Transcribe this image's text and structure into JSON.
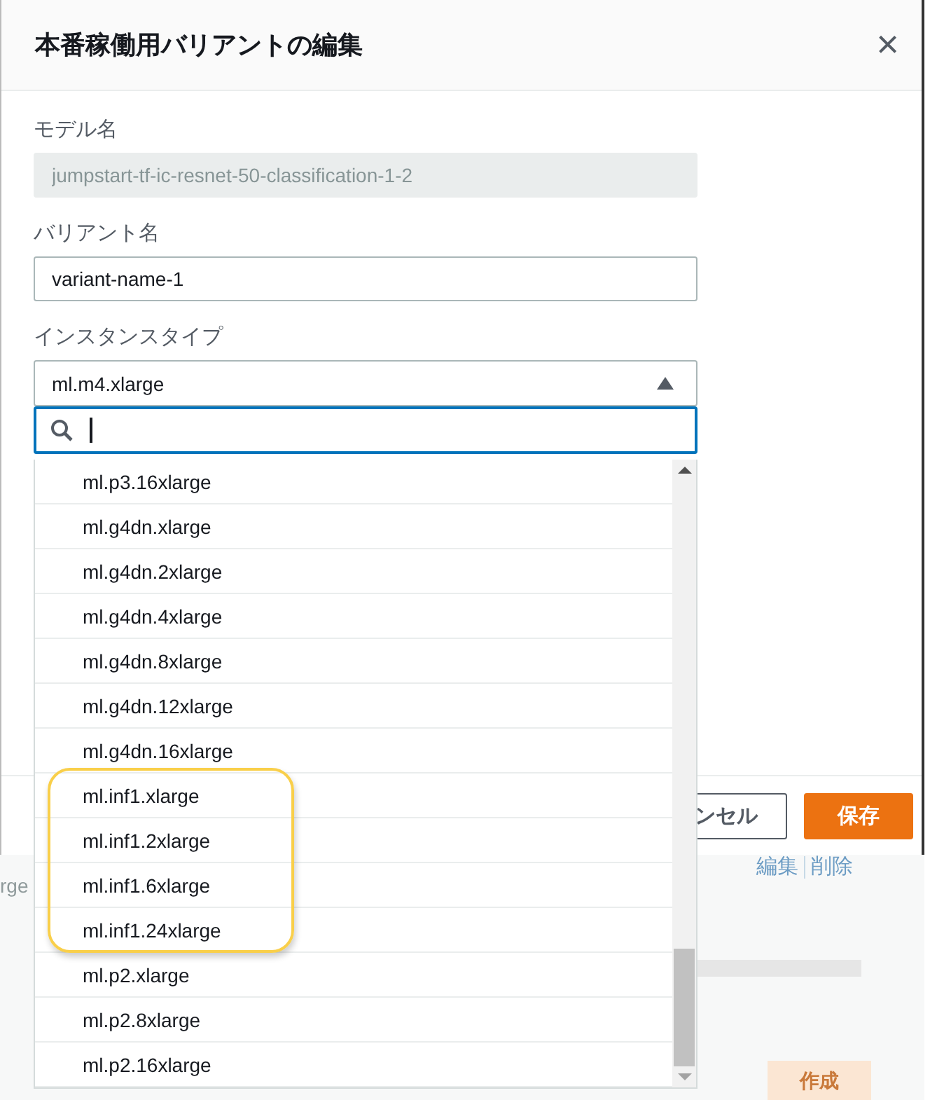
{
  "dialog": {
    "title": "本番稼働用バリアントの編集",
    "close": "×"
  },
  "fields": [
    {
      "label": "モデル名",
      "value": "jumpstart-tf-ic-resnet-50-classification-1-2",
      "disabled": true
    },
    {
      "label": "バリアント名",
      "value": "variant-name-1",
      "disabled": false
    }
  ],
  "instance_type": {
    "label": "インスタンスタイプ",
    "value": "ml.m4.xlarge",
    "expanded": true,
    "options": [
      {
        "kind": "option",
        "label": "ml.p3.16xlarge"
      },
      {
        "kind": "option",
        "label": "ml.g4dn.xlarge"
      },
      {
        "kind": "option",
        "label": "ml.g4dn.2xlarge"
      },
      {
        "kind": "option",
        "label": "ml.g4dn.4xlarge"
      },
      {
        "kind": "option",
        "label": "ml.g4dn.8xlarge"
      },
      {
        "kind": "option",
        "label": "ml.g4dn.12xlarge"
      },
      {
        "kind": "option",
        "label": "ml.g4dn.16xlarge"
      },
      {
        "kind": "highlight_group",
        "children": [
          {
            "label": "ml.inf1.xlarge"
          },
          {
            "label": "ml.inf1.2xlarge"
          },
          {
            "label": "ml.inf1.6xlarge"
          },
          {
            "label": "ml.inf1.24xlarge"
          }
        ]
      },
      {
        "kind": "option",
        "label": "ml.p2.xlarge"
      },
      {
        "kind": "option",
        "label": "ml.p2.8xlarge"
      },
      {
        "kind": "option",
        "label": "ml.p2.16xlarge"
      }
    ]
  },
  "buttons": [
    {
      "label": "ンセル",
      "kind": "secondary"
    },
    {
      "label": "保存",
      "kind": "primary"
    }
  ],
  "background": {
    "cell": "rge",
    "actions": [
      {
        "label": "編集"
      },
      {
        "label": "削除"
      }
    ],
    "button": "作成"
  }
}
